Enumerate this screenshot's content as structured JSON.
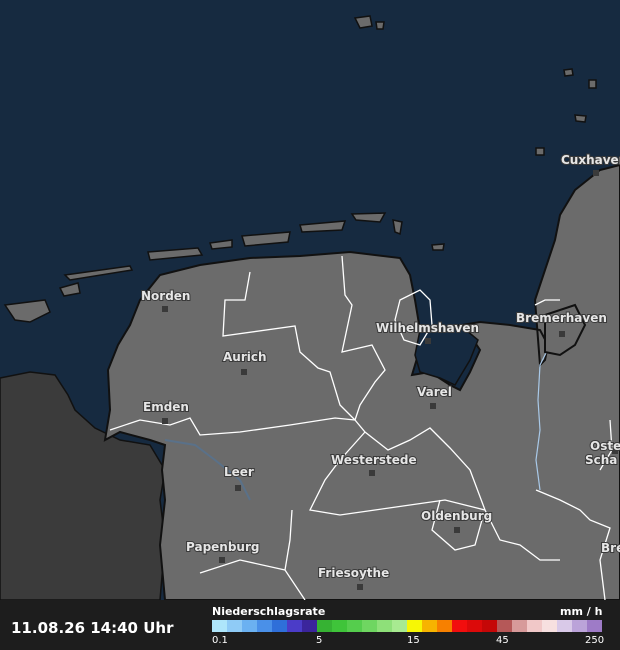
{
  "timestamp": "11.08.26 14:40 Uhr",
  "legend": {
    "title": "Niederschlagsrate",
    "unit": "mm / h",
    "ticks": [
      "0.1",
      "5",
      "15",
      "45",
      "250"
    ],
    "colors": [
      "#aee6fb",
      "#8fcbf6",
      "#6bb1f1",
      "#4a90e8",
      "#2f6fd9",
      "#4b3cc8",
      "#3b259c",
      "#36b233",
      "#3fc43a",
      "#55cd4d",
      "#6fd661",
      "#8ee079",
      "#a8ea91",
      "#f7f705",
      "#f7b400",
      "#f78000",
      "#f20e0e",
      "#dc0a0a",
      "#c50707",
      "#b55858",
      "#d79a9a",
      "#f1c8c8",
      "#f7e0e0",
      "#d9c9e8",
      "#bba3d9",
      "#9e7bc7"
    ]
  },
  "cities": [
    {
      "name": "Norden"
    },
    {
      "name": "Aurich"
    },
    {
      "name": "Emden"
    },
    {
      "name": "Leer"
    },
    {
      "name": "Papenburg"
    },
    {
      "name": "Wilhelmshaven"
    },
    {
      "name": "Varel"
    },
    {
      "name": "Westerstede"
    },
    {
      "name": "Oldenburg"
    },
    {
      "name": "Friesoythe"
    },
    {
      "name": "Bremerhaven"
    },
    {
      "name": "Cuxhaven"
    },
    {
      "name": "Oste"
    },
    {
      "name": "Scha"
    },
    {
      "name": "Bre"
    }
  ],
  "colors": {
    "sea": "#162a40",
    "land": "#6b6b6b",
    "netherlands": "#3b3b3b",
    "border": "#ffffff",
    "footer": "#1d1d1d"
  }
}
